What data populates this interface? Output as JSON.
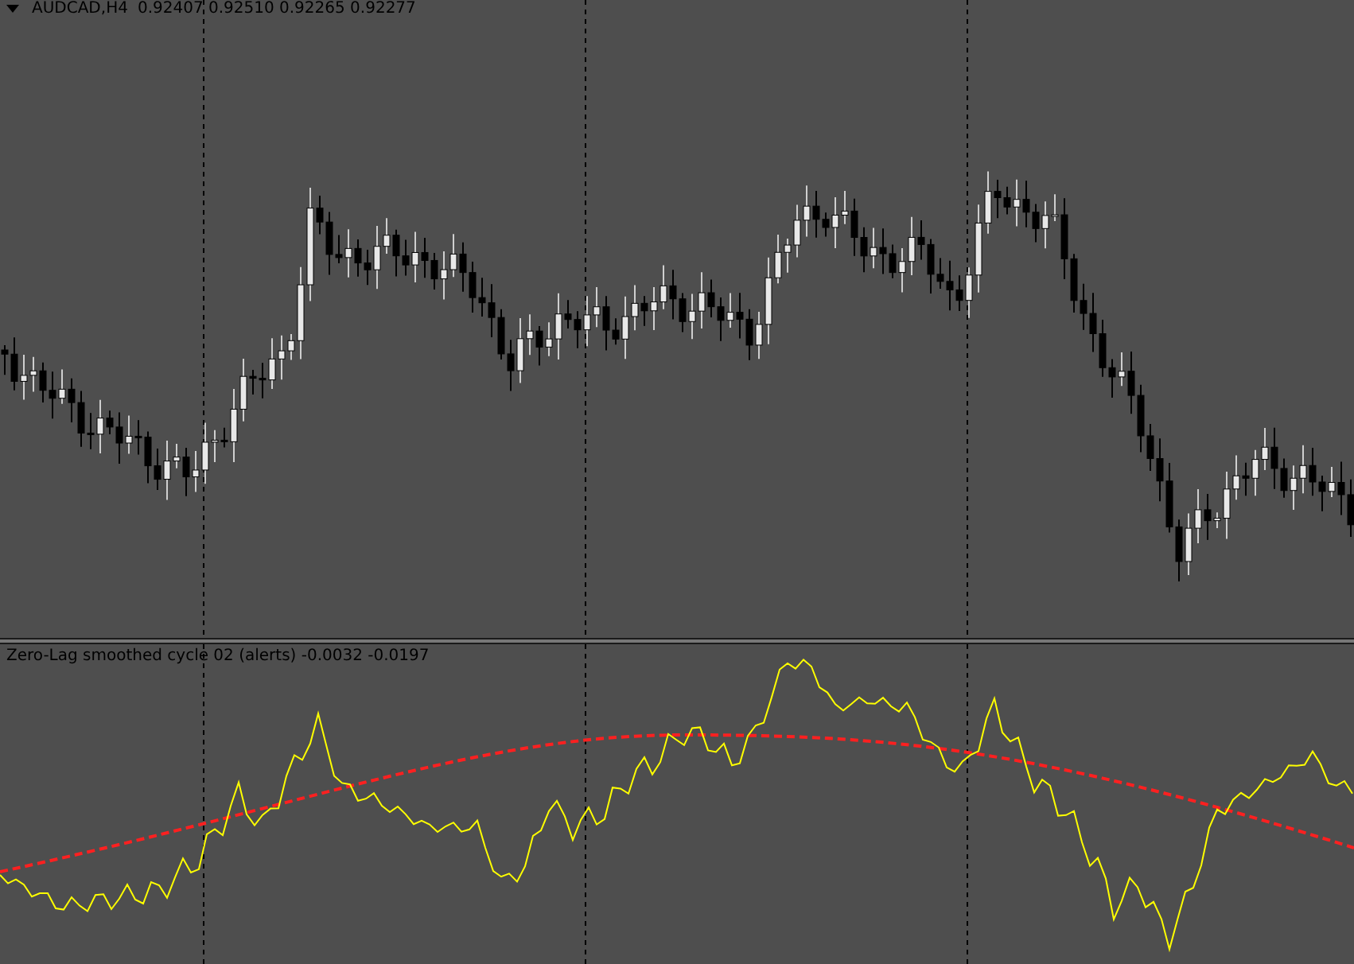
{
  "chart": {
    "symbol": "AUDCAD,H4",
    "quote": "0.92407 0.92510 0.92265 0.92277"
  },
  "indicator": {
    "label": "Zero-Lag smoothed cycle 02 (alerts) -0.0032 -0.0197"
  }
}
